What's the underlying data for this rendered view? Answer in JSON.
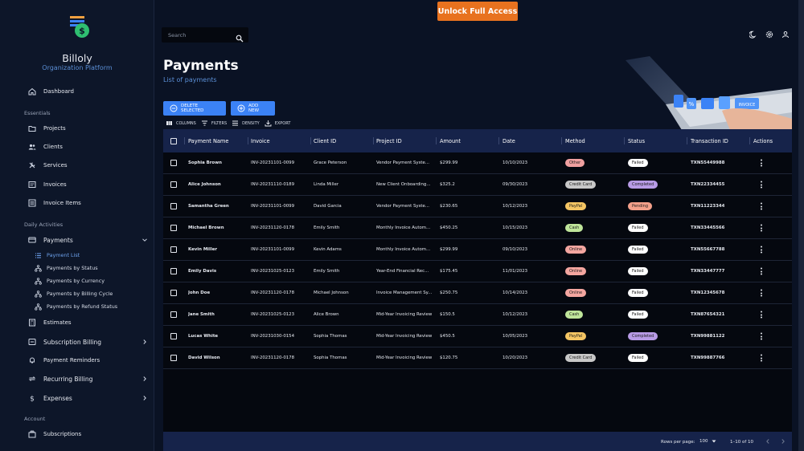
{
  "app": {
    "name": "Billoly",
    "subtitle": "Organization Platform",
    "unlock_label": "Unlock Full Access"
  },
  "sidebar": {
    "dashboard": "Dashboard",
    "section_essentials": "Essentials",
    "essentials": [
      {
        "label": "Projects",
        "icon": "folder-icon"
      },
      {
        "label": "Clients",
        "icon": "users-icon"
      },
      {
        "label": "Services",
        "icon": "tools-icon"
      },
      {
        "label": "Invoices",
        "icon": "invoice-icon"
      },
      {
        "label": "Invoice Items",
        "icon": "list-icon"
      }
    ],
    "section_daily": "Daily Activities",
    "payments": "Payments",
    "payments_sub": [
      {
        "label": "Payment List",
        "active": true
      },
      {
        "label": "Payments by Status"
      },
      {
        "label": "Payments by Currency"
      },
      {
        "label": "Payments by Billing Cycle"
      },
      {
        "label": "Payments by Refund Status"
      }
    ],
    "estimates": "Estimates",
    "subscription_billing": "Subscription Billing",
    "payment_reminders": "Payment Reminders",
    "recurring_billing": "Recurring Billing",
    "expenses": "Expenses",
    "section_account": "Account",
    "subscriptions": "Subscriptions"
  },
  "search": {
    "placeholder": "Search"
  },
  "header": {
    "title": "Payments",
    "subtitle": "List of payments"
  },
  "actions": {
    "delete_selected": "DELETE SELECTED",
    "add_new": "ADD NEW"
  },
  "toolbar": {
    "columns": "COLUMNS",
    "filters": "FILTERS",
    "density": "DENSITY",
    "export": "EXPORT"
  },
  "table": {
    "headers": [
      "Payment Name",
      "Invoice",
      "Client ID",
      "Project ID",
      "Amount",
      "Date",
      "Method",
      "Status",
      "Transaction ID",
      "Actions"
    ],
    "rows": [
      {
        "name": "Sophia Brown",
        "invoice": "INV-20231101-0099",
        "client": "Grace Peterson",
        "project": "Vendor Payment Syste...",
        "amount": "$299.99",
        "date": "10/10/2023",
        "method": "Other",
        "status": "Failed",
        "txn": "TXN55449988"
      },
      {
        "name": "Alice Johnson",
        "invoice": "INV-20231110-0189",
        "client": "Linda Miller",
        "project": "New Client Onboarding...",
        "amount": "$325.2",
        "date": "09/30/2023",
        "method": "Credit Card",
        "status": "Completed",
        "txn": "TXN22334455"
      },
      {
        "name": "Samantha Green",
        "invoice": "INV-20231101-0099",
        "client": "David Garcia",
        "project": "Vendor Payment Syste...",
        "amount": "$230.65",
        "date": "10/12/2023",
        "method": "PayPal",
        "status": "Pending",
        "txn": "TXN11223344"
      },
      {
        "name": "Michael Brown",
        "invoice": "INV-20231120-0178",
        "client": "Emily Smith",
        "project": "Monthly Invoice Autom...",
        "amount": "$450.25",
        "date": "10/15/2023",
        "method": "Cash",
        "status": "Failed",
        "txn": "TXN33445566"
      },
      {
        "name": "Kevin Miller",
        "invoice": "INV-20231101-0099",
        "client": "Kevin Adams",
        "project": "Monthly Invoice Autom...",
        "amount": "$299.99",
        "date": "09/10/2023",
        "method": "Online",
        "status": "Failed",
        "txn": "TXN55667788"
      },
      {
        "name": "Emily Davis",
        "invoice": "INV-20231025-0123",
        "client": "Emily Smith",
        "project": "Year-End Financial Rec...",
        "amount": "$175.45",
        "date": "11/01/2023",
        "method": "Online",
        "status": "Failed",
        "txn": "TXN33447777"
      },
      {
        "name": "John Doe",
        "invoice": "INV-20231120-0178",
        "client": "Michael Johnson",
        "project": "Invoice Management Sy...",
        "amount": "$250.75",
        "date": "10/14/2023",
        "method": "Online",
        "status": "Failed",
        "txn": "TXN12345678"
      },
      {
        "name": "Jane Smith",
        "invoice": "INV-20231025-0123",
        "client": "Alice Brown",
        "project": "Mid-Year Invoicing Review",
        "amount": "$150.5",
        "date": "10/12/2023",
        "method": "Cash",
        "status": "Failed",
        "txn": "TXN87654321"
      },
      {
        "name": "Lucas White",
        "invoice": "INV-20231030-0154",
        "client": "Sophia Thomas",
        "project": "Mid-Year Invoicing Review",
        "amount": "$450.5",
        "date": "10/05/2023",
        "method": "PayPal",
        "status": "Completed",
        "txn": "TXN99881122"
      },
      {
        "name": "David Wilson",
        "invoice": "INV-20231120-0178",
        "client": "Sophia Thomas",
        "project": "Mid-Year Invoicing Review",
        "amount": "$120.75",
        "date": "10/20/2023",
        "method": "Credit Card",
        "status": "Failed",
        "txn": "TXN99887766"
      }
    ]
  },
  "chip_colors": {
    "Other": "#f0a0a0",
    "Credit Card": "#c8c8c8",
    "PayPal": "#f5c563",
    "Cash": "#bfe59a",
    "Online": "#f4a6a0",
    "Failed": "#ffffff",
    "Completed": "#b89be6",
    "Pending": "#f4a08a"
  },
  "footer": {
    "rows_per_page_label": "Rows per page:",
    "rows_per_page_value": "100",
    "range": "1–10 of 10"
  }
}
